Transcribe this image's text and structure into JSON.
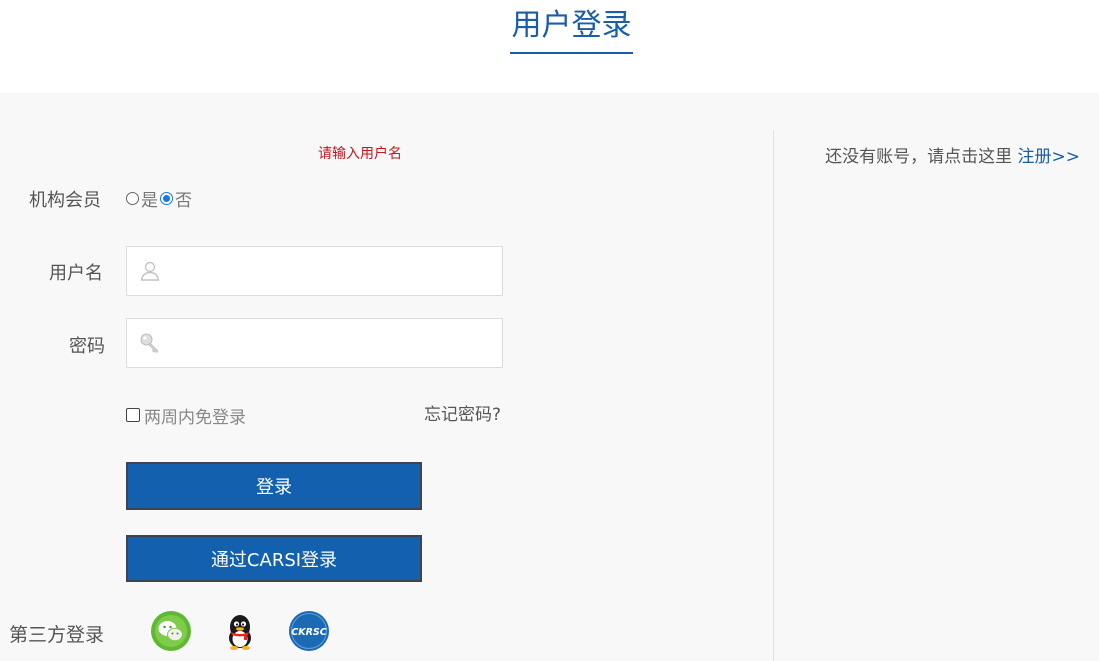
{
  "page": {
    "title": "用户登录"
  },
  "form": {
    "error_message": "请输入用户名",
    "institution_label": "机构会员",
    "institution_options": [
      {
        "label": "是",
        "checked": false
      },
      {
        "label": "否",
        "checked": true
      }
    ],
    "username_label": "用户名",
    "username_value": "",
    "password_label": "密码",
    "password_value": "",
    "remember_label": "两周内免登录",
    "remember_checked": false,
    "forgot_label": "忘记密码?",
    "login_button": "登录",
    "carsi_button": "通过CARSI登录",
    "third_party_label": "第三方登录",
    "third_party": [
      {
        "name": "wechat",
        "icon": "wechat-icon"
      },
      {
        "name": "qq",
        "icon": "qq-icon"
      },
      {
        "name": "ckrsc",
        "icon": "ckrsc-icon",
        "text": "CKRSC"
      }
    ]
  },
  "register": {
    "prompt": "还没有账号，请点击这里 ",
    "link_label": "注册>>"
  },
  "colors": {
    "accent": "#1a5ea8",
    "button": "#1260ae",
    "error": "#c8161d",
    "panel_bg": "#f8f8f8"
  }
}
